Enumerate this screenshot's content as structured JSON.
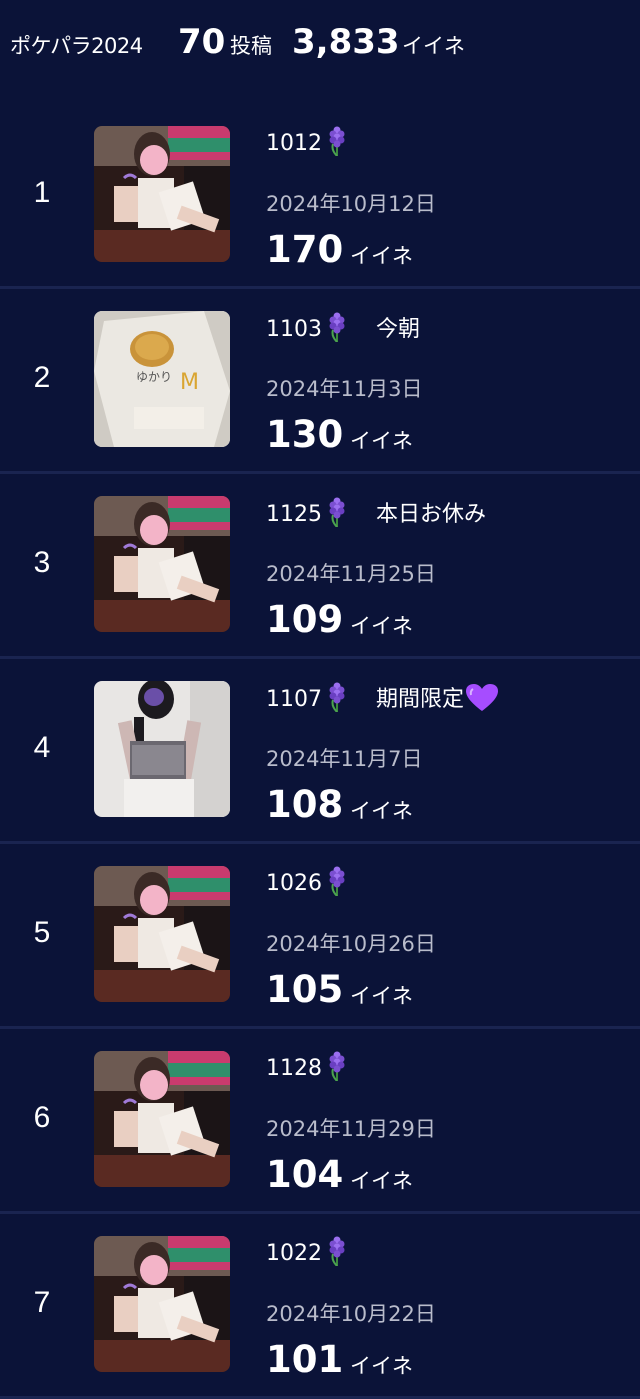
{
  "header": {
    "label": "ポケパラ2024",
    "posts_count": "70",
    "posts_unit": "投稿",
    "likes_count": "3,833",
    "likes_unit": "イイネ"
  },
  "rows": [
    {
      "rank": "1",
      "title": "1012",
      "extra": "",
      "date": "2024年10月12日",
      "likes": "170",
      "likes_unit": "イイネ",
      "thumb": "photo-a",
      "heart": false
    },
    {
      "rank": "2",
      "title": "1103",
      "extra": "今朝",
      "date": "2024年11月3日",
      "likes": "130",
      "likes_unit": "イイネ",
      "thumb": "photo-b",
      "heart": false
    },
    {
      "rank": "3",
      "title": "1125",
      "extra": "本日お休み",
      "date": "2024年11月25日",
      "likes": "109",
      "likes_unit": "イイネ",
      "thumb": "photo-a",
      "heart": false
    },
    {
      "rank": "4",
      "title": "1107",
      "extra": "期間限定",
      "date": "2024年11月7日",
      "likes": "108",
      "likes_unit": "イイネ",
      "thumb": "photo-c",
      "heart": true
    },
    {
      "rank": "5",
      "title": "1026",
      "extra": "",
      "date": "2024年10月26日",
      "likes": "105",
      "likes_unit": "イイネ",
      "thumb": "photo-a",
      "heart": false
    },
    {
      "rank": "6",
      "title": "1128",
      "extra": "",
      "date": "2024年11月29日",
      "likes": "104",
      "likes_unit": "イイネ",
      "thumb": "photo-a",
      "heart": false
    },
    {
      "rank": "7",
      "title": "1022",
      "extra": "",
      "date": "2024年10月22日",
      "likes": "101",
      "likes_unit": "イイネ",
      "thumb": "photo-a",
      "heart": false
    }
  ],
  "colors": {
    "background": "#0b1338",
    "divider": "#1a2450",
    "date_text": "#b9bccb",
    "flower": "#7b4fd1",
    "heart": "#a64dff"
  },
  "icons": {
    "flower": "hyacinth-icon",
    "heart": "purple-heart-icon"
  }
}
